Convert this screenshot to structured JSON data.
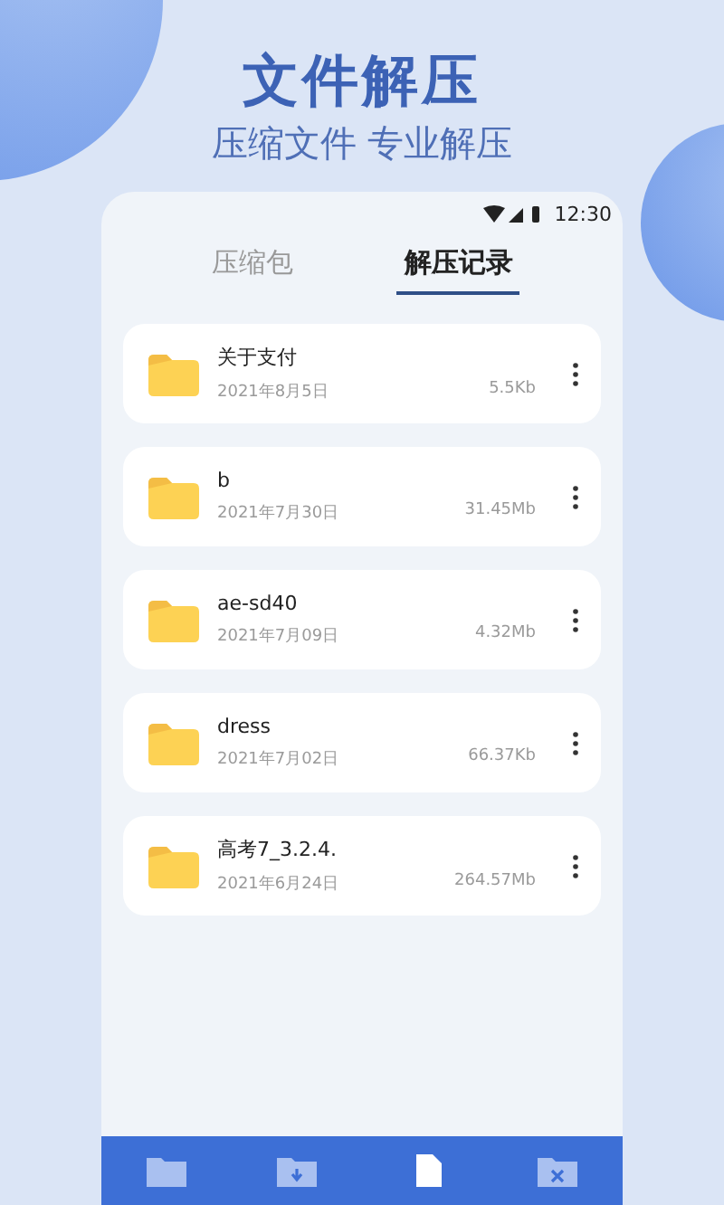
{
  "headline": "文件解压",
  "tagline": "压缩文件 专业解压",
  "status_bar": {
    "time": "12:30"
  },
  "tabs": [
    {
      "label": "压缩包",
      "selected": false
    },
    {
      "label": "解压记录",
      "selected": true
    }
  ],
  "files": [
    {
      "name": "关于支付",
      "date": "2021年8月5日",
      "size": "5.5Kb"
    },
    {
      "name": "b",
      "date": "2021年7月30日",
      "size": "31.45Mb"
    },
    {
      "name": "ae-sd40",
      "date": "2021年7月09日",
      "size": "4.32Mb"
    },
    {
      "name": "dress",
      "date": "2021年7月02日",
      "size": "66.37Kb"
    },
    {
      "name": "高考7_3.2.4.",
      "date": "2021年6月24日",
      "size": "264.57Mb"
    }
  ],
  "bottom_nav": [
    {
      "kind": "folder",
      "selected": false
    },
    {
      "kind": "download",
      "selected": false
    },
    {
      "kind": "file",
      "selected": true
    },
    {
      "kind": "archive",
      "selected": false
    }
  ]
}
